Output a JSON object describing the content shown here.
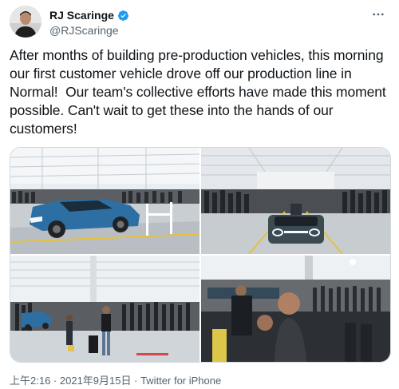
{
  "author": {
    "display_name": "RJ Scaringe",
    "handle": "@RJScaringe",
    "verified": true
  },
  "icons": {
    "verified": "verified-badge-icon",
    "more": "more-options-icon",
    "avatar": "profile-photo"
  },
  "tweet": {
    "text": "After months of building pre-production vehicles, this morning our first customer vehicle drove off our production line in Normal!  Our team's collective efforts have made this moment possible. Can't wait to get these into the hands of our customers!"
  },
  "media": {
    "photos": [
      "factory-photo-blue-truck",
      "factory-photo-crowd-front",
      "factory-photo-wide-floor",
      "factory-photo-crowd-closeup"
    ]
  },
  "meta": {
    "time": "上午2:16",
    "separator1": " · ",
    "date": "2021年9月15日",
    "separator2": " · ",
    "source": "Twitter for iPhone"
  },
  "colors": {
    "verified_blue": "#1d9bf0",
    "text": "#0f1419",
    "secondary": "#536471",
    "truck_blue": "#2d6fa3"
  }
}
